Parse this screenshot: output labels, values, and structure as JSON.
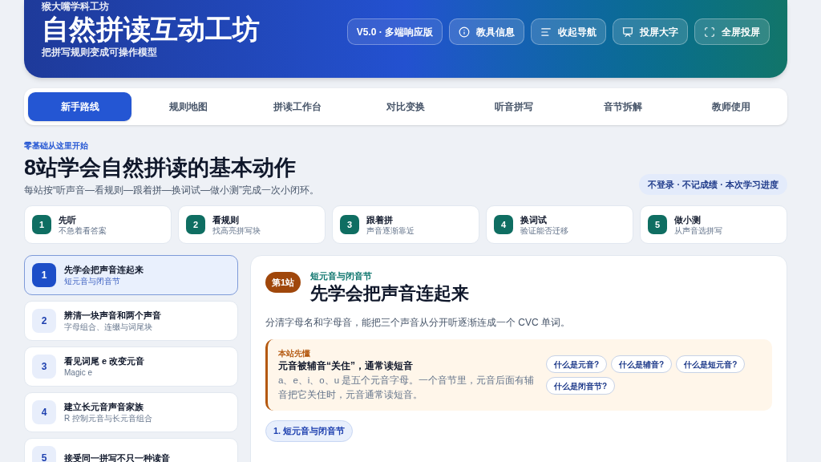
{
  "header": {
    "brand": "猴大嘴学科工坊",
    "title": "自然拼读互动工坊",
    "subtitle": "把拼写规则变成可操作模型",
    "version": "V5.0 · 多端响应版",
    "buttons": [
      {
        "kind": "info",
        "label": "教具信息"
      },
      {
        "kind": "menu",
        "label": "收起导航"
      },
      {
        "kind": "projector",
        "label": "投屏大字"
      },
      {
        "kind": "fullscreen",
        "label": "全屏投屏"
      }
    ]
  },
  "tabs": [
    {
      "label": "新手路线",
      "selected": true
    },
    {
      "label": "规则地图",
      "selected": false
    },
    {
      "label": "拼读工作台",
      "selected": false
    },
    {
      "label": "对比变换",
      "selected": false
    },
    {
      "label": "听音拼写",
      "selected": false
    },
    {
      "label": "音节拆解",
      "selected": false
    },
    {
      "label": "教师使用",
      "selected": false
    }
  ],
  "intro": {
    "eyebrow": "零基础从这里开始",
    "title": "8站学会自然拼读的基本动作",
    "description": "每站按“听声音—看规则—跟着拼—换词试—做小测”完成一次小闭环。",
    "note": "不登录 · 不记成绩 · 本次学习进度"
  },
  "steps": [
    {
      "number": "1",
      "title": "先听",
      "hint": "不急着看答案"
    },
    {
      "number": "2",
      "title": "看规则",
      "hint": "找高亮拼写块"
    },
    {
      "number": "3",
      "title": "跟着拼",
      "hint": "声音逐渐靠近"
    },
    {
      "number": "4",
      "title": "换词试",
      "hint": "验证能否迁移"
    },
    {
      "number": "5",
      "title": "做小测",
      "hint": "从声音选拼写"
    }
  ],
  "stations": [
    {
      "number": "1",
      "title": "先学会把声音连起来",
      "subtitle": "短元音与闭音节",
      "selected": true
    },
    {
      "number": "2",
      "title": "辨清一块声音和两个声音",
      "subtitle": "字母组合、连缀与词尾块",
      "selected": false
    },
    {
      "number": "3",
      "title": "看见词尾 e 改变元音",
      "subtitle": "Magic e",
      "selected": false
    },
    {
      "number": "4",
      "title": "建立长元音声音家族",
      "subtitle": "R 控制元音与长元音组合",
      "selected": false
    },
    {
      "number": "5",
      "title": "接受同一拼写不只一种读音",
      "selected": false
    }
  ],
  "detail": {
    "badge": "第1站",
    "topic": "短元音与闭音节",
    "title": "先学会把声音连起来",
    "description": "分清字母名和字母音，能把三个声音从分开听逐渐连成一个 CVC 单词。",
    "callout": {
      "label": "本站先懂",
      "heading": "元音被辅音“关住”，通常读短音",
      "body": "a、e、i、o、u 是五个元音字母。一个音节里，元音后面有辅音把它关住时，元音通常读短音。",
      "questions": [
        "什么是元音?",
        "什么是辅音?",
        "什么是短元音?",
        "什么是闭音节?"
      ]
    },
    "section": "1. 短元音与闭音节"
  }
}
